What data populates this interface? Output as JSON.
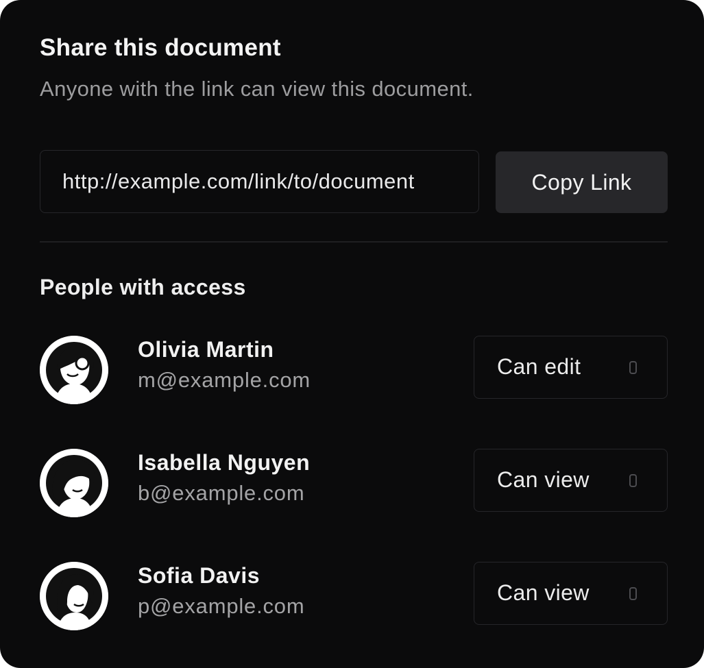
{
  "dialog": {
    "title": "Share this document",
    "subtitle": "Anyone with the link can view this document."
  },
  "link": {
    "value": "http://example.com/link/to/document",
    "copy_label": "Copy Link"
  },
  "people": {
    "heading": "People with access",
    "list": [
      {
        "name": "Olivia Martin",
        "email": "m@example.com",
        "permission": "Can edit",
        "avatar_icon": "woman-avatar-icon"
      },
      {
        "name": "Isabella Nguyen",
        "email": "b@example.com",
        "permission": "Can view",
        "avatar_icon": "woman-avatar-icon"
      },
      {
        "name": "Sofia Davis",
        "email": "p@example.com",
        "permission": "Can view",
        "avatar_icon": "woman-avatar-icon"
      }
    ]
  },
  "colors": {
    "background": "#0b0b0c",
    "button_bg": "#27272a",
    "border": "#26262a",
    "muted_text": "#9d9d9f"
  }
}
